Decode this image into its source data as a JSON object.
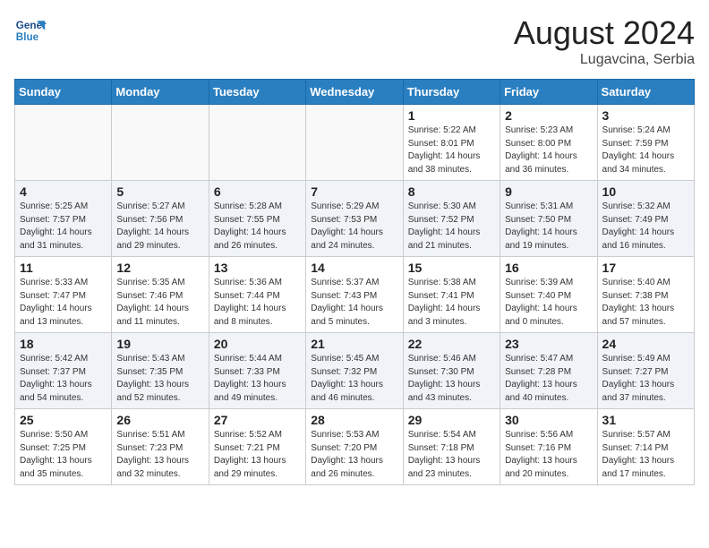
{
  "header": {
    "logo_line1": "General",
    "logo_line2": "Blue",
    "month_year": "August 2024",
    "location": "Lugavcina, Serbia"
  },
  "weekdays": [
    "Sunday",
    "Monday",
    "Tuesday",
    "Wednesday",
    "Thursday",
    "Friday",
    "Saturday"
  ],
  "weeks": [
    [
      {
        "day": "",
        "info": ""
      },
      {
        "day": "",
        "info": ""
      },
      {
        "day": "",
        "info": ""
      },
      {
        "day": "",
        "info": ""
      },
      {
        "day": "1",
        "info": "Sunrise: 5:22 AM\nSunset: 8:01 PM\nDaylight: 14 hours\nand 38 minutes."
      },
      {
        "day": "2",
        "info": "Sunrise: 5:23 AM\nSunset: 8:00 PM\nDaylight: 14 hours\nand 36 minutes."
      },
      {
        "day": "3",
        "info": "Sunrise: 5:24 AM\nSunset: 7:59 PM\nDaylight: 14 hours\nand 34 minutes."
      }
    ],
    [
      {
        "day": "4",
        "info": "Sunrise: 5:25 AM\nSunset: 7:57 PM\nDaylight: 14 hours\nand 31 minutes."
      },
      {
        "day": "5",
        "info": "Sunrise: 5:27 AM\nSunset: 7:56 PM\nDaylight: 14 hours\nand 29 minutes."
      },
      {
        "day": "6",
        "info": "Sunrise: 5:28 AM\nSunset: 7:55 PM\nDaylight: 14 hours\nand 26 minutes."
      },
      {
        "day": "7",
        "info": "Sunrise: 5:29 AM\nSunset: 7:53 PM\nDaylight: 14 hours\nand 24 minutes."
      },
      {
        "day": "8",
        "info": "Sunrise: 5:30 AM\nSunset: 7:52 PM\nDaylight: 14 hours\nand 21 minutes."
      },
      {
        "day": "9",
        "info": "Sunrise: 5:31 AM\nSunset: 7:50 PM\nDaylight: 14 hours\nand 19 minutes."
      },
      {
        "day": "10",
        "info": "Sunrise: 5:32 AM\nSunset: 7:49 PM\nDaylight: 14 hours\nand 16 minutes."
      }
    ],
    [
      {
        "day": "11",
        "info": "Sunrise: 5:33 AM\nSunset: 7:47 PM\nDaylight: 14 hours\nand 13 minutes."
      },
      {
        "day": "12",
        "info": "Sunrise: 5:35 AM\nSunset: 7:46 PM\nDaylight: 14 hours\nand 11 minutes."
      },
      {
        "day": "13",
        "info": "Sunrise: 5:36 AM\nSunset: 7:44 PM\nDaylight: 14 hours\nand 8 minutes."
      },
      {
        "day": "14",
        "info": "Sunrise: 5:37 AM\nSunset: 7:43 PM\nDaylight: 14 hours\nand 5 minutes."
      },
      {
        "day": "15",
        "info": "Sunrise: 5:38 AM\nSunset: 7:41 PM\nDaylight: 14 hours\nand 3 minutes."
      },
      {
        "day": "16",
        "info": "Sunrise: 5:39 AM\nSunset: 7:40 PM\nDaylight: 14 hours\nand 0 minutes."
      },
      {
        "day": "17",
        "info": "Sunrise: 5:40 AM\nSunset: 7:38 PM\nDaylight: 13 hours\nand 57 minutes."
      }
    ],
    [
      {
        "day": "18",
        "info": "Sunrise: 5:42 AM\nSunset: 7:37 PM\nDaylight: 13 hours\nand 54 minutes."
      },
      {
        "day": "19",
        "info": "Sunrise: 5:43 AM\nSunset: 7:35 PM\nDaylight: 13 hours\nand 52 minutes."
      },
      {
        "day": "20",
        "info": "Sunrise: 5:44 AM\nSunset: 7:33 PM\nDaylight: 13 hours\nand 49 minutes."
      },
      {
        "day": "21",
        "info": "Sunrise: 5:45 AM\nSunset: 7:32 PM\nDaylight: 13 hours\nand 46 minutes."
      },
      {
        "day": "22",
        "info": "Sunrise: 5:46 AM\nSunset: 7:30 PM\nDaylight: 13 hours\nand 43 minutes."
      },
      {
        "day": "23",
        "info": "Sunrise: 5:47 AM\nSunset: 7:28 PM\nDaylight: 13 hours\nand 40 minutes."
      },
      {
        "day": "24",
        "info": "Sunrise: 5:49 AM\nSunset: 7:27 PM\nDaylight: 13 hours\nand 37 minutes."
      }
    ],
    [
      {
        "day": "25",
        "info": "Sunrise: 5:50 AM\nSunset: 7:25 PM\nDaylight: 13 hours\nand 35 minutes."
      },
      {
        "day": "26",
        "info": "Sunrise: 5:51 AM\nSunset: 7:23 PM\nDaylight: 13 hours\nand 32 minutes."
      },
      {
        "day": "27",
        "info": "Sunrise: 5:52 AM\nSunset: 7:21 PM\nDaylight: 13 hours\nand 29 minutes."
      },
      {
        "day": "28",
        "info": "Sunrise: 5:53 AM\nSunset: 7:20 PM\nDaylight: 13 hours\nand 26 minutes."
      },
      {
        "day": "29",
        "info": "Sunrise: 5:54 AM\nSunset: 7:18 PM\nDaylight: 13 hours\nand 23 minutes."
      },
      {
        "day": "30",
        "info": "Sunrise: 5:56 AM\nSunset: 7:16 PM\nDaylight: 13 hours\nand 20 minutes."
      },
      {
        "day": "31",
        "info": "Sunrise: 5:57 AM\nSunset: 7:14 PM\nDaylight: 13 hours\nand 17 minutes."
      }
    ]
  ]
}
